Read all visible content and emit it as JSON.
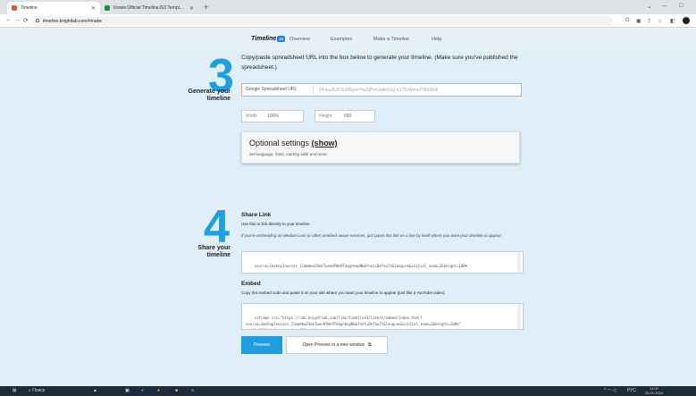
{
  "browser": {
    "tabs": [
      {
        "title": "Timeline",
        "color": "#e0533c",
        "active": true
      },
      {
        "title": "Копия Official TimelineJS3 Templ...",
        "color": "#1e8e3e",
        "active": false
      }
    ],
    "url": "timeline.knightlab.com/#make",
    "window_controls": [
      "⌄",
      "–",
      "□"
    ]
  },
  "site_nav": {
    "logo": "Timeline",
    "logo_badge": "JS",
    "links": [
      "Overview",
      "Examples",
      "Make a Timeline",
      "Help"
    ]
  },
  "step3": {
    "number": "3",
    "label": "Generate your timeline",
    "intro": "Copy/paste spreadsheet URL into the box below to generate your timeline. (Make sure you've published the spreadsheet.)",
    "url_label": "Google Spreadsheet URL",
    "url_value": "1N4qaBZE3o8RgxeYiwSlPmUqkk0Gg-a1TKnMmcFNb6Bv8",
    "width_label": "Width",
    "width_value": "100%",
    "height_label": "Height",
    "height_value": "650",
    "optional_title": "Optional settings",
    "optional_show": "(show)",
    "optional_desc": "Set language, fonts, starting slide and more."
  },
  "step4": {
    "number": "4",
    "label": "Share your timeline",
    "share_title": "Share Link",
    "share_desc": "Use this to link directly to your timeline.",
    "share_medium": "If you're embedding on Medium.com or other oembed-aware services, just paste this link on a line by itself where you want your timeline to appear.",
    "share_code": "source=1mzhnp1nocvsz_1lmmmkaZ4ekTwen0YWn9TdqqnbepNb&font=Default&lang=en&initial_zoom=2&height=100%",
    "embed_title": "Embed",
    "embed_desc": "Copy this embed code and paste it on your site where you want your timeline to appear (just like a YouTube video).",
    "embed_code": "<iframe src=\"https://cdn.knightlab.com/libs/timeline3/latest/embed/index.html?\nsource=1mzhnp1nocvsz_1lmmmkaZ4ekTwen0YWn9TdqqnbepNb&font=Default&lang=en&initial_zoom=2&height=100%\"\nwidth=\"100%\" frameborder=\"0\"></iframe>",
    "preview_button": "Preview",
    "open_button": "Open Preview in a new window"
  },
  "taskbar": {
    "search": "Поиск",
    "lang": "РУС",
    "time": "11:00",
    "date": "25.01.2024"
  },
  "colors": {
    "accent": "#1e9fe0",
    "bg": "#dfeef8",
    "url_border": "#e6a58b"
  }
}
